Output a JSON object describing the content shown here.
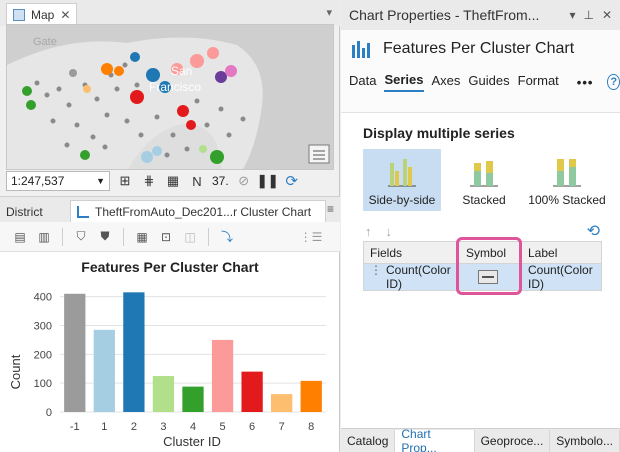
{
  "map_pane": {
    "tab_label": "Map",
    "place_labels": [
      "Gate",
      "San",
      "Francisco"
    ],
    "scale_value": "1:247,537",
    "status_value": "37.",
    "icons": [
      "map-icon",
      "close-icon",
      "layers-icon",
      "grid-icon",
      "north-arrow-icon",
      "pause-icon",
      "refresh-icon",
      "basemap-icon"
    ]
  },
  "chart_view": {
    "tab_district": "District",
    "tab_chart": "TheftFromAuto_Dec201...r Cluster Chart",
    "chart_data": {
      "type": "bar",
      "title": "Features Per Cluster Chart",
      "xlabel": "Cluster ID",
      "ylabel": "Count",
      "categories": [
        "-1",
        "1",
        "2",
        "3",
        "4",
        "5",
        "6",
        "7",
        "8"
      ],
      "values": [
        410,
        285,
        415,
        125,
        88,
        250,
        140,
        62,
        108
      ],
      "colors": [
        "#9b9b9b",
        "#a6cee3",
        "#1f78b4",
        "#b2df8a",
        "#33a02c",
        "#fb9a99",
        "#e31a1c",
        "#fdbf6f",
        "#ff7f00"
      ],
      "ylim": [
        0,
        430
      ],
      "yticks": [
        "0",
        "100",
        "200",
        "300",
        "400"
      ],
      "grid": true
    }
  },
  "props": {
    "pane_title": "Chart Properties - TheftFrom...",
    "chart_title": "Features Per Cluster Chart",
    "tabs": [
      "Data",
      "Series",
      "Axes",
      "Guides",
      "Format"
    ],
    "active_tab": "Series",
    "more": "•••",
    "help": "?",
    "section_title": "Display multiple series",
    "series_options": [
      "Side-by-side",
      "Stacked",
      "100% Stacked"
    ],
    "selected_option": "Side-by-side",
    "table_headers": [
      "Fields",
      "Symbol",
      "Label"
    ],
    "table_row": {
      "field": "Count(Color ID)",
      "label": "Count(Color ID)"
    },
    "bottom_tabs": [
      "Catalog",
      "Chart Prop...",
      "Geoproce...",
      "Symbolo..."
    ],
    "active_bottom_tab": "Chart Prop..."
  }
}
